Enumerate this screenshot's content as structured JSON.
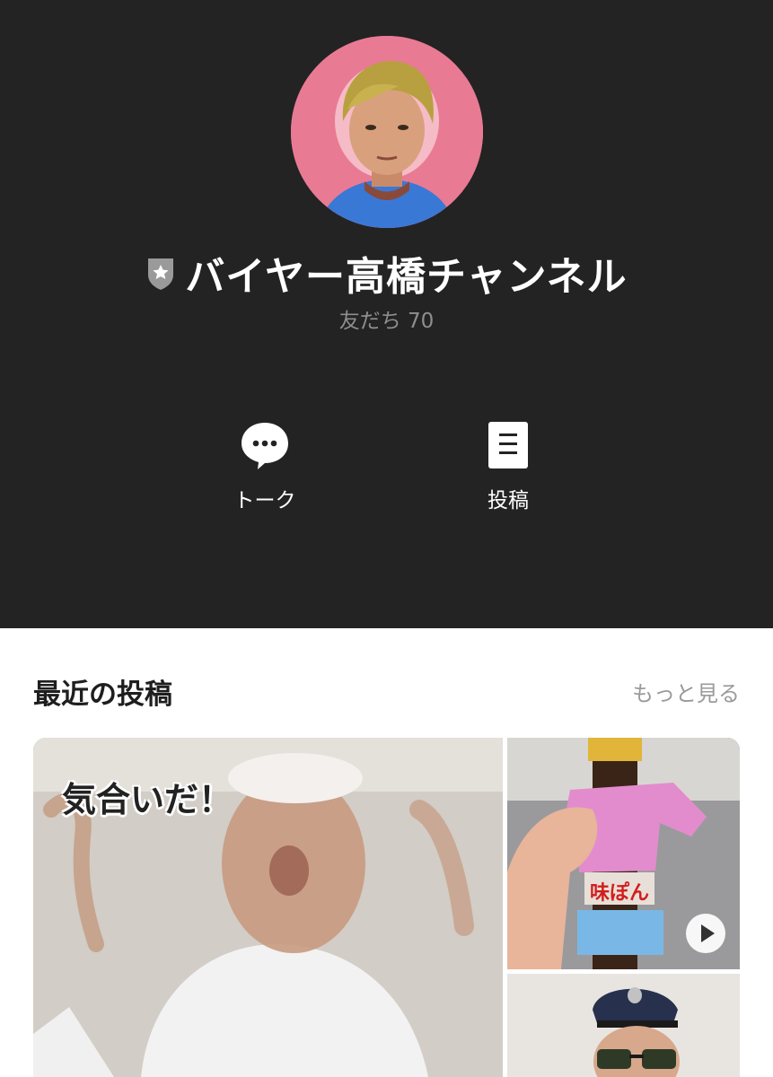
{
  "profile": {
    "name": "バイヤー高橋チャンネル",
    "friends": "友だち 70"
  },
  "actions": {
    "talk_label": "トーク",
    "post_label": "投稿"
  },
  "recent": {
    "title": "最近の投稿",
    "more_label": "もっと見る",
    "posts": [
      {
        "caption": "気合いだ！"
      },
      {
        "label": "味ぽん"
      },
      {
        "kind": "photo"
      }
    ]
  },
  "colors": {
    "header_bg": "#232323",
    "avatar_bg": "#e97a93",
    "muted_text": "#8e8e8e"
  },
  "icons": {
    "badge": "certified-shield-icon",
    "talk": "chat-bubble-icon",
    "post": "document-icon",
    "play": "play-icon"
  }
}
